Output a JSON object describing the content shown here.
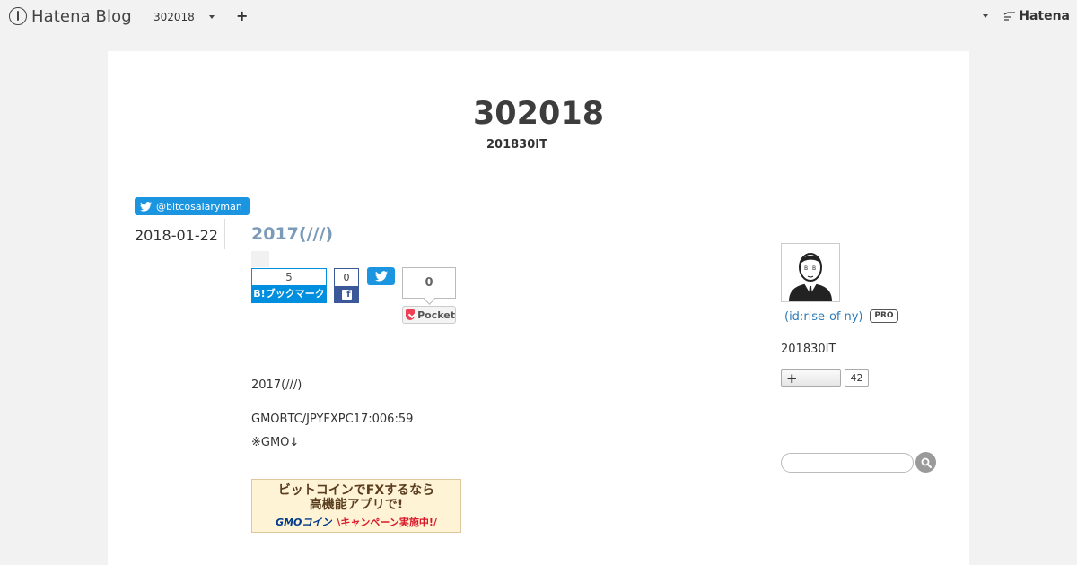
{
  "topbar": {
    "logo_text": "Hatena Blog",
    "blog_name": "302018",
    "brand": "Hatena"
  },
  "blog": {
    "title": "302018",
    "description": "201830IT"
  },
  "follow": {
    "twitter_handle": "@bitcosalaryman"
  },
  "entry": {
    "date": "2018-01-22",
    "title": "2017(///)",
    "share": {
      "hatena_count": "5",
      "hatena_label": "B!ブックマーク",
      "facebook_count": "0",
      "pocket_count": "0",
      "pocket_label": "Pocket"
    },
    "paragraphs": [
      "2017(///)",
      "GMOBTC/JPYFXPC17:006:59",
      "※GMO↓"
    ],
    "banner": {
      "line1": "ビットコインでFXするなら",
      "line2": "高機能アプリで!",
      "logo": "GMOコイン",
      "campaign": "\\キャンペーン実施中!/"
    }
  },
  "sidebar": {
    "profile_id": "(id:rise-of-ny)",
    "pro_badge": "PRO",
    "profile_desc": "201830IT",
    "reader_count": "42",
    "search_placeholder": ""
  },
  "colors": {
    "twitter": "#1b95e0",
    "hatena_bookmark": "#008fde",
    "facebook": "#3b5998",
    "pocket": "#ef4056",
    "link": "#2b7bb9",
    "entry_title": "#7a9ab8"
  }
}
